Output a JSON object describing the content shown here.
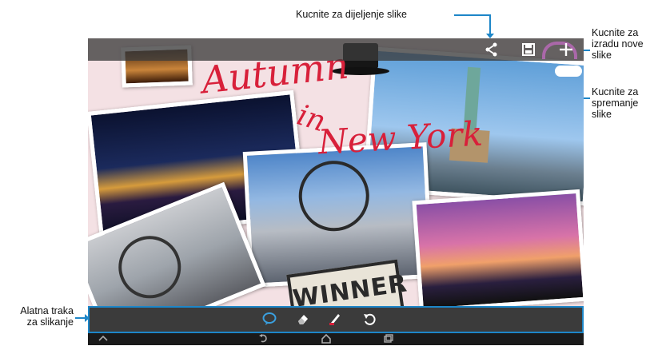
{
  "callouts": {
    "share": "Kucnite za dijeljenje slike",
    "new_line1": "Kucnite za",
    "new_line2": "izradu nove",
    "new_line3": "slike",
    "save_line1": "Kucnite za",
    "save_line2": "spremanje",
    "save_line3": "slike",
    "toolbar_line1": "Alatna traka",
    "toolbar_line2": "za slikanje"
  },
  "canvas": {
    "handwriting_1": "Autumn",
    "handwriting_2": "in",
    "handwriting_3": "New York",
    "winner_sign": "WINNER"
  },
  "colors": {
    "accent": "#1d86c8",
    "ink": "#d8203a"
  },
  "icons": {
    "topbar": [
      "share-icon",
      "save-icon",
      "add-icon"
    ],
    "paint_toolbar": [
      "speech-bubble-icon",
      "eraser-icon",
      "pen-icon",
      "undo-icon"
    ],
    "navbar": [
      "chevron-up-icon",
      "back-icon",
      "home-icon",
      "recent-apps-icon"
    ]
  }
}
